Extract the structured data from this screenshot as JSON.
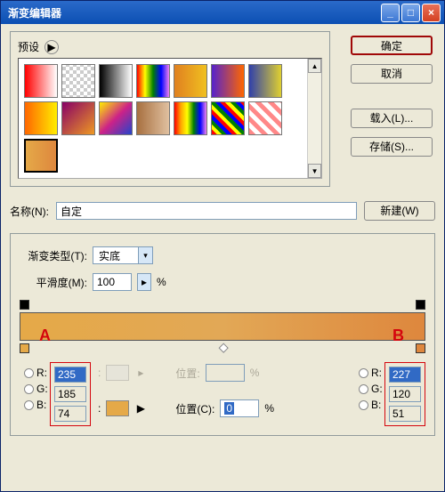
{
  "window": {
    "title": "渐变编辑器",
    "minimize": "_",
    "maximize": "□",
    "close": "×"
  },
  "presets": {
    "label": "预设",
    "play_icon": "▶"
  },
  "buttons": {
    "ok": "确定",
    "cancel": "取消",
    "load": "载入(L)...",
    "save": "存储(S)...",
    "new": "新建(W)"
  },
  "name": {
    "label": "名称(N):",
    "value": "自定"
  },
  "gradient": {
    "type_label": "渐变类型(T):",
    "type_value": "实底",
    "smooth_label": "平滑度(M):",
    "smooth_value": "100",
    "smooth_unit": "%"
  },
  "markers": {
    "A": "A",
    "B": "B"
  },
  "rgbA": {
    "R_label": "R:",
    "R": "235",
    "G_label": "G:",
    "G": "185",
    "B_label": "B:",
    "B": "74"
  },
  "rgbB": {
    "R_label": "R:",
    "R": "227",
    "G_label": "G:",
    "G": "120",
    "B_label": "B:",
    "B": "51"
  },
  "mid": {
    "pos_disabled_label": "位置:",
    "pos_disabled_unit": "%",
    "color_label": ":",
    "play": "▶",
    "pos_label": "位置(C):",
    "pos_value": "0",
    "pos_unit": "%"
  },
  "colors": {
    "accentA": "#e5a948",
    "accentB": "#de873d",
    "gradStart": "#e5a948",
    "gradEnd": "#de873d"
  },
  "chart_data": {
    "type": "table",
    "title": "Gradient color stops (RGB)",
    "series": [
      {
        "name": "Stop A (left)",
        "values": {
          "R": 235,
          "G": 185,
          "B": 74
        }
      },
      {
        "name": "Stop B (right)",
        "values": {
          "R": 227,
          "G": 120,
          "B": 51
        }
      }
    ],
    "position_C": 0,
    "smoothness_pct": 100,
    "gradient_type": "实底"
  }
}
